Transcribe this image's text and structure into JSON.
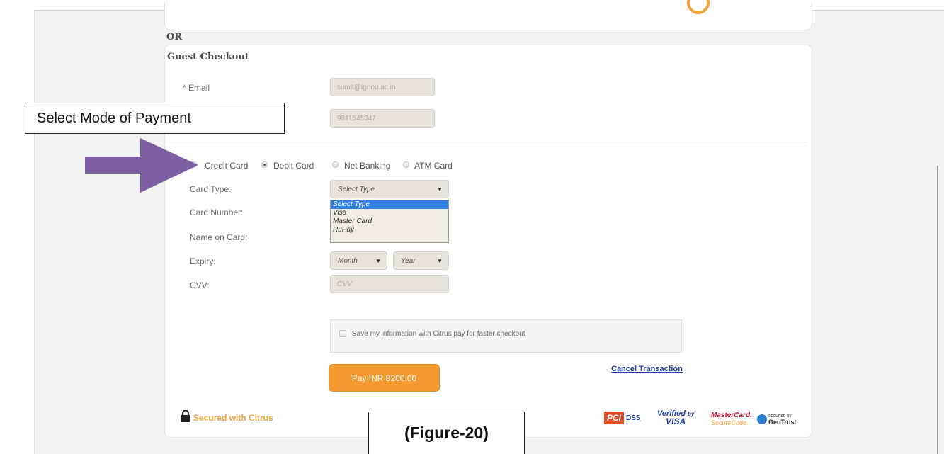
{
  "or_label": "OR",
  "guest_checkout": {
    "title": "Guest Checkout",
    "email_label": "* Email",
    "email_value": "sumit@ignou.ac.in",
    "phone_value": "9811545347"
  },
  "payment_modes": [
    "Credit Card",
    "Debit Card",
    "Net Banking",
    "ATM Card"
  ],
  "selected_payment_mode": "Debit Card",
  "card_form": {
    "card_type_label": "Card Type:",
    "card_type_value": "Select Type",
    "card_type_options": [
      "Select Type",
      "Visa",
      "Master Card",
      "RuPay"
    ],
    "card_number_label": "Card Number:",
    "name_label": "Name on Card:",
    "expiry_label": "Expiry:",
    "month_value": "Month",
    "year_value": "Year",
    "cvv_label": "CVV:",
    "cvv_placeholder": "CVV"
  },
  "save_info_label": "Save my information with Citrus pay for faster checkout",
  "pay_button": "Pay INR 8200.00",
  "cancel_link": "Cancel Transaction",
  "secured_label": "Secured with Citrus",
  "badges": {
    "pci": "PCI",
    "dss": "DSS",
    "verified": "Verified",
    "by": "by",
    "visa": "VISA",
    "mastercard": "MasterCard.",
    "securecode": "SecureCode.",
    "geotrust_secured": "SECURED BY",
    "geotrust": "GeoTrust"
  },
  "annotations": {
    "callout": "Select Mode of Payment",
    "figure": "(Figure-20)"
  },
  "colors": {
    "accent_orange": "#f49a2e",
    "link_blue": "#1d3c9c",
    "arrow_purple": "#7d5ea3",
    "dropdown_selected": "#2f7fe0"
  }
}
